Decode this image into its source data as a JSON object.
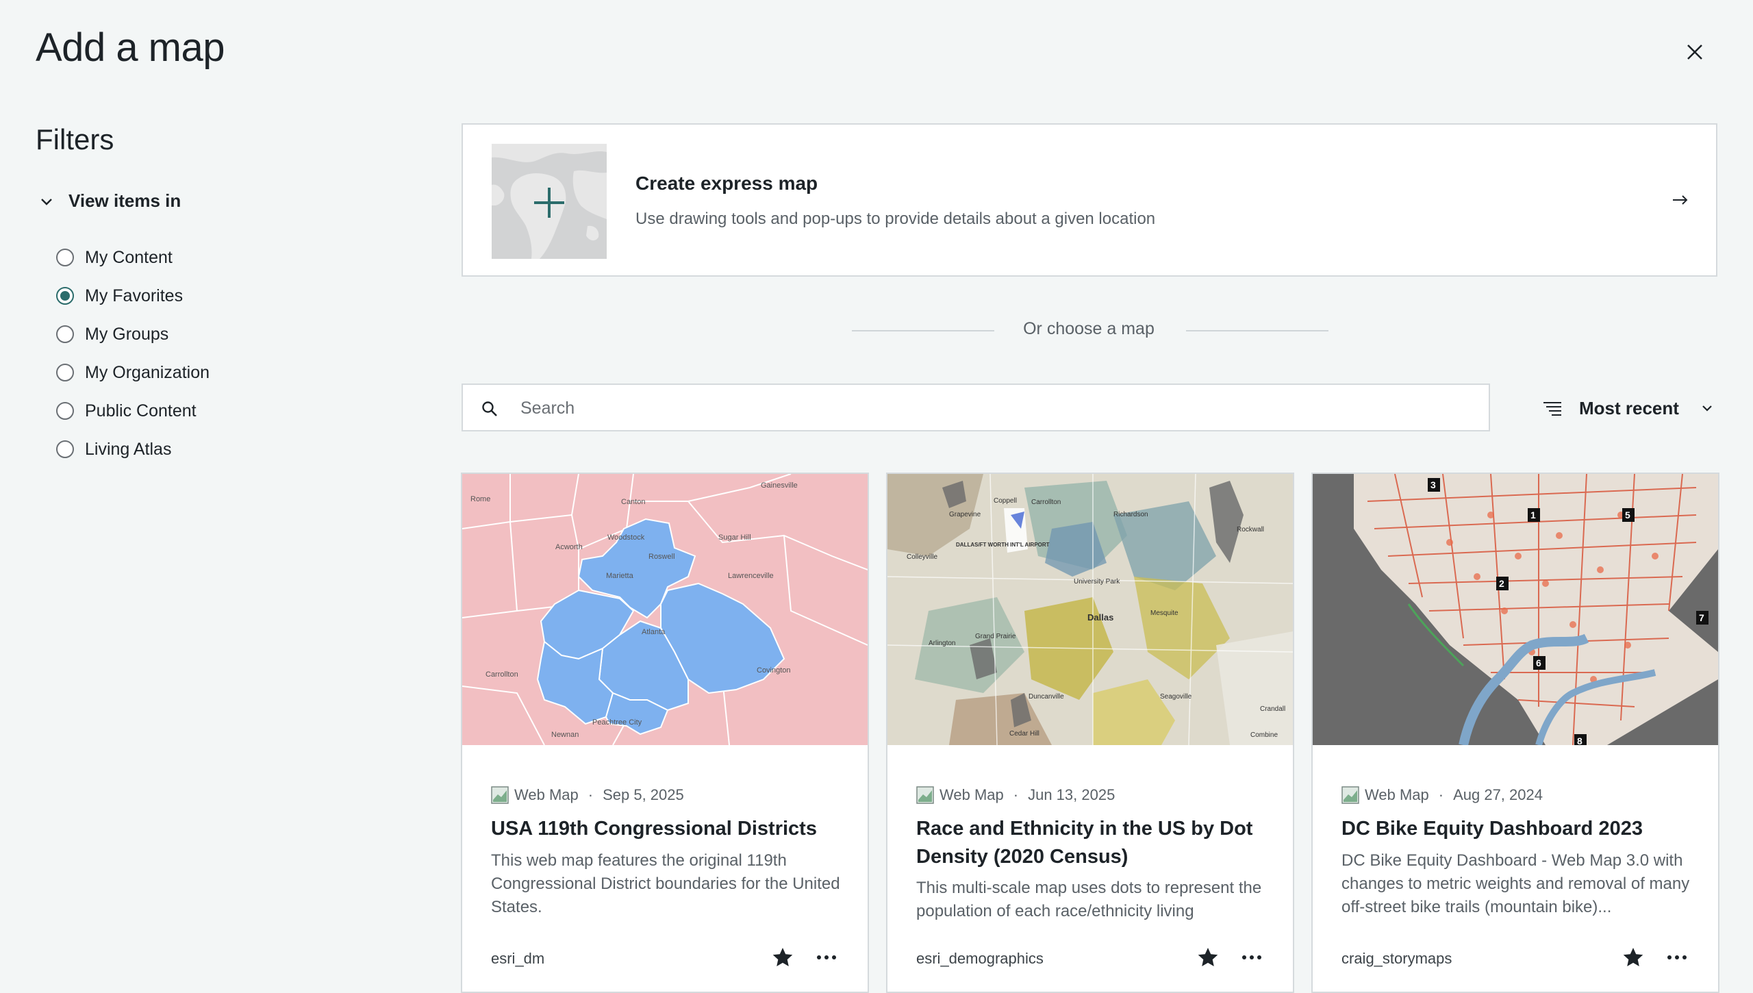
{
  "header": {
    "title": "Add a map"
  },
  "filters": {
    "title": "Filters",
    "section_label": "View items in",
    "options": [
      {
        "label": "My Content",
        "checked": false
      },
      {
        "label": "My Favorites",
        "checked": true
      },
      {
        "label": "My Groups",
        "checked": false
      },
      {
        "label": "My Organization",
        "checked": false
      },
      {
        "label": "Public Content",
        "checked": false
      },
      {
        "label": "Living Atlas",
        "checked": false
      }
    ]
  },
  "express": {
    "title": "Create express map",
    "description": "Use drawing tools and pop-ups to provide details about a given location"
  },
  "divider": {
    "label": "Or choose a map"
  },
  "search": {
    "placeholder": "Search",
    "value": ""
  },
  "sort": {
    "label": "Most recent"
  },
  "colors": {
    "accent": "#2b6c6b",
    "text": "#1d2328",
    "muted": "#5a6167",
    "border": "#d5dadd"
  },
  "cards": [
    {
      "type": "Web Map",
      "date": "Sep 5, 2025",
      "title": "USA 119th Congressional Districts",
      "description": "This web map features the original 119th Congressional District boundaries for the United States.",
      "owner": "esri_dm",
      "favorited": true,
      "thumb_labels": [
        "Rome",
        "Canton",
        "Gainesville",
        "Woodstock",
        "Sugar Hill",
        "Acworth",
        "Roswell",
        "Marietta",
        "Lawrenceville",
        "Atlanta",
        "Carrollton",
        "Covington",
        "Peachtree City",
        "Newnan"
      ]
    },
    {
      "type": "Web Map",
      "date": "Jun 13, 2025",
      "title": "Race and Ethnicity in the US by Dot Density (2020 Census)",
      "description": "This multi-scale map uses dots to represent the population of each race/ethnicity living",
      "owner": "esri_demographics",
      "favorited": true,
      "thumb_labels": [
        "Grapevine",
        "Coppell",
        "Carrollton",
        "Richardson",
        "Rockwall",
        "Colleyville",
        "DALLAS/FT WORTH INT'L AIRPORT",
        "University Park",
        "Dallas",
        "Mesquite",
        "Arlington",
        "Grand Prairie",
        "Duncanville",
        "Seagoville",
        "Cedar Hill",
        "Crandall",
        "Combine"
      ]
    },
    {
      "type": "Web Map",
      "date": "Aug 27, 2024",
      "title": "DC Bike Equity Dashboard 2023",
      "description": "DC Bike Equity Dashboard - Web Map 3.0 with changes to metric weights and removal of many off-street bike trails (mountain bike)...",
      "owner": "craig_storymaps",
      "favorited": true,
      "thumb_labels": [
        "3",
        "1",
        "5",
        "2",
        "7",
        "6",
        "8"
      ]
    }
  ]
}
